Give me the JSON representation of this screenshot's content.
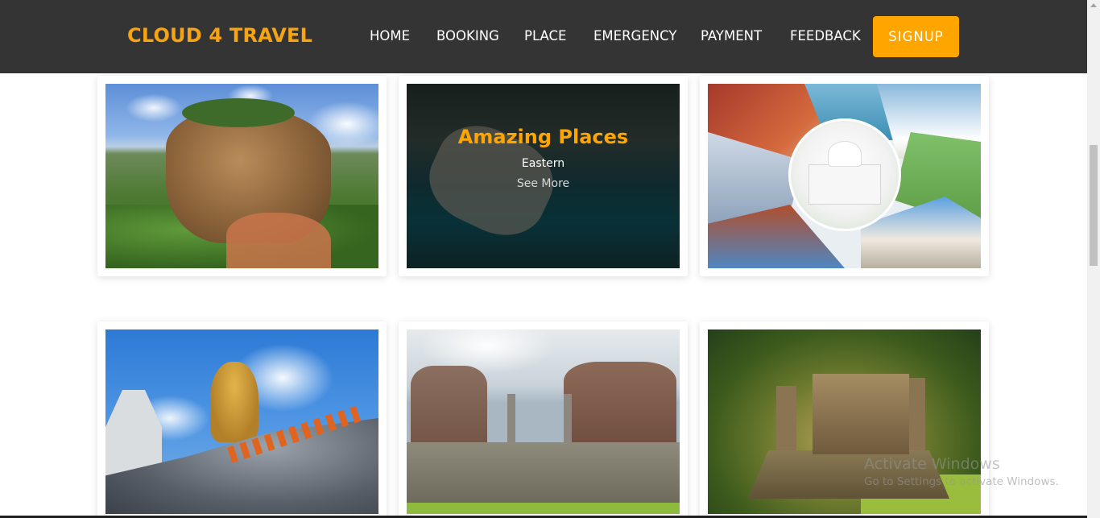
{
  "navbar": {
    "brand": "CLOUD 4 TRAVEL",
    "items": [
      {
        "label": "HOME"
      },
      {
        "label": "BOOKING"
      },
      {
        "label": "PLACE"
      },
      {
        "label": "EMERGENCY"
      },
      {
        "label": "PAYMENT"
      },
      {
        "label": "FEEDBACK"
      }
    ],
    "signup_label": "SIGNUP"
  },
  "cards": {
    "featured": {
      "title": "Amazing Places",
      "subtitle": "Eastern",
      "link": "See More"
    }
  },
  "watermark": {
    "title": "Activate Windows",
    "subtitle": "Go to Settings to activate Windows."
  },
  "colors": {
    "navbar_bg": "#343434",
    "brand": "#f7a414",
    "accent": "#ffa500"
  }
}
